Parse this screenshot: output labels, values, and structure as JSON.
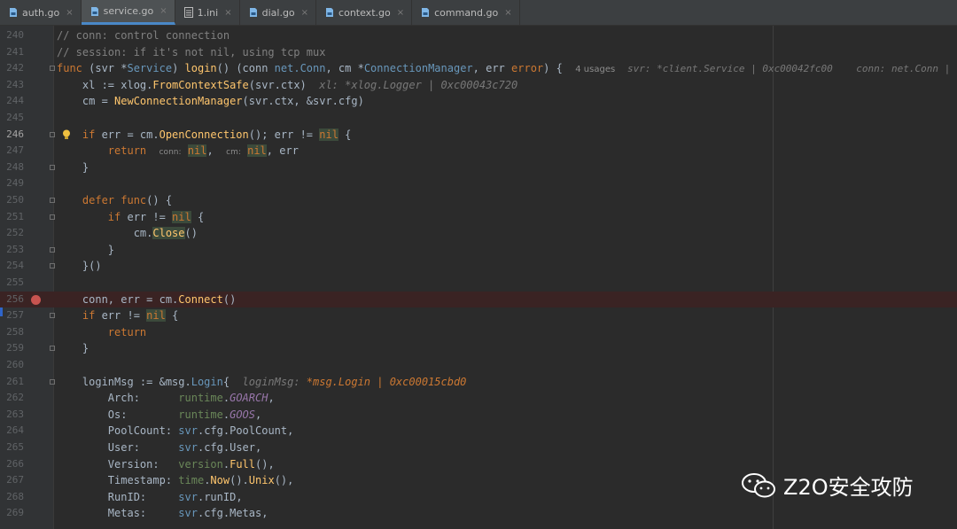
{
  "tabs": [
    {
      "label": "auth.go",
      "active": false,
      "icon": "go-file-icon"
    },
    {
      "label": "service.go",
      "active": true,
      "icon": "go-file-icon"
    },
    {
      "label": "1.ini",
      "active": false,
      "icon": "ini-file-icon"
    },
    {
      "label": "dial.go",
      "active": false,
      "icon": "go-file-icon"
    },
    {
      "label": "context.go",
      "active": false,
      "icon": "go-file-icon"
    },
    {
      "label": "command.go",
      "active": false,
      "icon": "go-file-icon"
    }
  ],
  "close_glyph": "×",
  "lines": [
    {
      "n": "240",
      "html": "<span class='cm'>// conn: control connection</span>"
    },
    {
      "n": "241",
      "html": "<span class='cm'>// session: if it's not nil, using tcp mux</span>"
    },
    {
      "n": "242",
      "html": "<span class='kw'>func</span> (svr *<span class='ty'>Service</span>) <span class='fn'>login</span>() (conn <span class='ty'>net.Conn</span>, cm *<span class='ty'>ConnectionManager</span>, err <span class='kw'>error</span>) {  <span class='usages'>4 usages</span>"
    },
    {
      "n": "243",
      "html": "    xl := xlog.<span class='fn'>FromContextSafe</span>(svr.ctx)  <span class='inlinehint'>xl: *xlog.Logger | 0xc00043c720</span>"
    },
    {
      "n": "244",
      "html": "    cm = <span class='fn'>NewConnectionManager</span>(svr.ctx, &amp;svr.cfg)"
    },
    {
      "n": "245",
      "html": ""
    },
    {
      "n": "246",
      "html": "    <span class='kw'>if</span> err = cm.<span class='fn'>OpenConnection</span>(); err != <span class='nilhl'>nil</span> {"
    },
    {
      "n": "247",
      "html": "        <span class='kw'>return</span>  <span class='hintbox'>conn:</span> <span class='nilhl'>nil</span>,  <span class='hintbox'>cm:</span> <span class='nilhl'>nil</span>, err"
    },
    {
      "n": "248",
      "html": "    }"
    },
    {
      "n": "249",
      "html": ""
    },
    {
      "n": "250",
      "html": "    <span class='kw'>defer func</span>() {"
    },
    {
      "n": "251",
      "html": "        <span class='kw'>if</span> err != <span class='nilhl'>nil</span> {"
    },
    {
      "n": "252",
      "html": "            cm.<span class='closehl'>Close</span>()"
    },
    {
      "n": "253",
      "html": "        }"
    },
    {
      "n": "254",
      "html": "    }()"
    },
    {
      "n": "255",
      "html": ""
    },
    {
      "n": "256",
      "html": "    conn, err = cm.<span class='fn'>Connect</span>()"
    },
    {
      "n": "257",
      "html": "    <span class='kw'>if</span> err != <span class='nilhl'>nil</span> {"
    },
    {
      "n": "258",
      "html": "        <span class='kw'>return</span>"
    },
    {
      "n": "259",
      "html": "    }"
    },
    {
      "n": "260",
      "html": ""
    },
    {
      "n": "261",
      "html": "    loginMsg := &amp;msg.<span class='ty'>Login</span>{  <span class='inlinehint'>loginMsg: <span class='orange-italic'>*msg.Login | 0xc00015cbd0</span></span>"
    },
    {
      "n": "262",
      "html": "        Arch:      <span class='st'>runtime</span>.<span class='pk ital'>GOARCH</span>,"
    },
    {
      "n": "263",
      "html": "        Os:        <span class='st'>runtime</span>.<span class='pk ital'>GOOS</span>,"
    },
    {
      "n": "264",
      "html": "        PoolCount: <span class='ty'>svr</span>.cfg.PoolCount,"
    },
    {
      "n": "265",
      "html": "        User:      <span class='ty'>svr</span>.cfg.User,"
    },
    {
      "n": "266",
      "html": "        Version:   <span class='st'>version</span>.<span class='fn'>Full</span>(),"
    },
    {
      "n": "267",
      "html": "        Timestamp: <span class='st'>time</span>.<span class='fn'>Now</span>().<span class='fn'>Unix</span>(),"
    },
    {
      "n": "268",
      "html": "        RunID:     <span class='ty'>svr</span>.runID,"
    },
    {
      "n": "269",
      "html": "        Metas:     <span class='ty'>svr</span>.cfg.Metas,"
    }
  ],
  "debug_hint_line242": "svr: *client.Service | 0xc00042fc00    conn: net.Conn |",
  "watermark": "Z2O安全攻防",
  "colors": {
    "background": "#2b2b2b",
    "gutter": "#313335",
    "breakpoint": "#c75450",
    "keyword": "#cc7832"
  }
}
